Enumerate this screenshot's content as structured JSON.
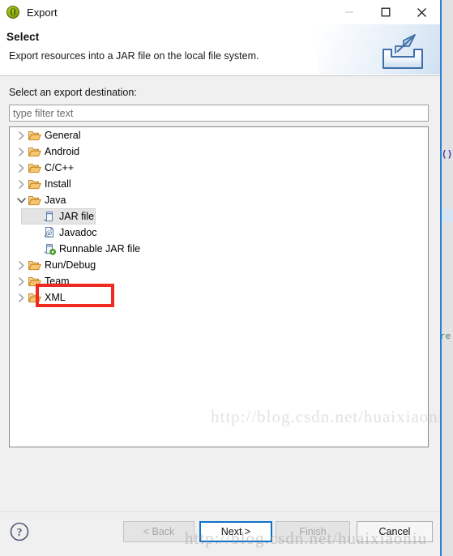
{
  "window": {
    "title": "Export",
    "app_icon": "eclipse-export-icon",
    "controls": {
      "minimize_label": "Minimize",
      "maximize_label": "Maximize",
      "close_label": "Close"
    }
  },
  "header": {
    "title": "Select",
    "description": "Export resources into a JAR file on the local file system.",
    "banner_icon": "export-arrow-icon"
  },
  "main": {
    "destination_label": "Select an export destination:",
    "filter": {
      "value": "",
      "placeholder": "type filter text"
    },
    "tree": [
      {
        "label": "General",
        "icon": "folder-icon",
        "level": 0,
        "state": "collapsed",
        "selected": false
      },
      {
        "label": "Android",
        "icon": "folder-icon",
        "level": 0,
        "state": "collapsed",
        "selected": false
      },
      {
        "label": "C/C++",
        "icon": "folder-icon",
        "level": 0,
        "state": "collapsed",
        "selected": false
      },
      {
        "label": "Install",
        "icon": "folder-icon",
        "level": 0,
        "state": "collapsed",
        "selected": false
      },
      {
        "label": "Java",
        "icon": "folder-icon",
        "level": 0,
        "state": "expanded",
        "selected": false
      },
      {
        "label": "JAR file",
        "icon": "jar-icon",
        "level": 1,
        "state": "leaf",
        "selected": true
      },
      {
        "label": "Javadoc",
        "icon": "javadoc-icon",
        "level": 1,
        "state": "leaf",
        "selected": false
      },
      {
        "label": "Runnable JAR file",
        "icon": "runnable-jar-icon",
        "level": 1,
        "state": "leaf",
        "selected": false
      },
      {
        "label": "Run/Debug",
        "icon": "folder-icon",
        "level": 0,
        "state": "collapsed",
        "selected": false
      },
      {
        "label": "Team",
        "icon": "folder-icon",
        "level": 0,
        "state": "collapsed",
        "selected": false
      },
      {
        "label": "XML",
        "icon": "folder-icon",
        "level": 0,
        "state": "collapsed",
        "selected": false
      }
    ],
    "annotation": {
      "kind": "red-highlight-rectangle",
      "targets": "JAR file",
      "color": "#ef2a21"
    }
  },
  "footer": {
    "help_icon": "help-question-icon",
    "buttons": [
      {
        "key": "back",
        "label": "< Back",
        "state": "disabled"
      },
      {
        "key": "next",
        "label": "Next >",
        "state": "focused"
      },
      {
        "key": "finish",
        "label": "Finish",
        "state": "disabled"
      },
      {
        "key": "cancel",
        "label": "Cancel",
        "state": "enabled"
      }
    ]
  },
  "watermark": {
    "text": "http://blog.csdn.net/huaixiaoniu"
  },
  "background": {
    "code_fragment_1": "()",
    "code_fragment_2": "re"
  },
  "colors": {
    "dialog_bg": "#f0f0f0",
    "panel_bg": "#ffffff",
    "accent_focus": "#0f72c8",
    "annotation_red": "#ef2a21",
    "folder_icon": "#e8a33d",
    "title_icon_green": "#8ead14"
  }
}
